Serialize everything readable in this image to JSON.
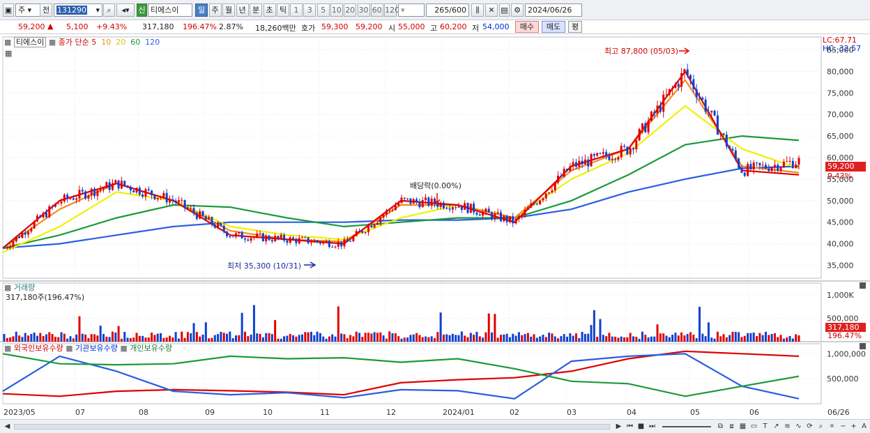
{
  "toolbar": {
    "type_label": "주",
    "prev_label": "전",
    "code": "131290",
    "stock_badge": "신",
    "stock_name": "티에스이",
    "periods": [
      "일",
      "주",
      "월",
      "년",
      "분",
      "초",
      "틱"
    ],
    "intervals": [
      "1",
      "3",
      "5",
      "10",
      "20",
      "30",
      "60",
      "120"
    ],
    "count": "265",
    "count_total": "/600",
    "date": "2024/06/26"
  },
  "quote": {
    "price": "59,200",
    "change": "5,100",
    "change_pct": "+9.43%",
    "volume": "317,180",
    "volume_pct": "196.47%",
    "turnover_pct": "2.87%",
    "amount": "18,260백만",
    "hoga_label": "호가",
    "ask": "59,300",
    "bid": "59,200",
    "open_label": "시",
    "open": "55,000",
    "high_label": "고",
    "high": "60,200",
    "low_label": "저",
    "low": "54,000",
    "buy_label": "매수",
    "sell_label": "매도",
    "avg_label": "평"
  },
  "legend": {
    "name": "티에스이",
    "price_label": "종가",
    "ma_label": "단순",
    "ma_periods": [
      "5",
      "10",
      "20",
      "60",
      "120"
    ],
    "ma_colors": [
      "#e00000",
      "#f08c1e",
      "#f0f000",
      "#1a9a3a",
      "#2a5ee0"
    ],
    "lc": "LC:67.71",
    "hc": "HC:-32.57"
  },
  "annotations": {
    "high": "최고 87,800 (05/03)",
    "low": "최저 35,300 (10/31)",
    "dividend": "배당락(0.00%)",
    "last_price": "59,200",
    "last_pct": "9.43%"
  },
  "volume_panel": {
    "title": "거래량",
    "value": "317,180주(196.47%)",
    "last": "317,180",
    "last_pct": "196.47%",
    "ticks": [
      "1,000K",
      "500,000"
    ]
  },
  "holding_panel": {
    "legend": [
      "외국인보유수량",
      "기관보유수량",
      "개인보유수량"
    ],
    "colors": [
      "#e00000",
      "#2a5ee0",
      "#1a9a3a"
    ],
    "ticks": [
      "1,000,000",
      "500,000"
    ]
  },
  "x_labels": [
    "2023/05",
    "07",
    "08",
    "09",
    "10",
    "11",
    "12",
    "2024/01",
    "02",
    "03",
    "04",
    "05",
    "06",
    "06/26"
  ],
  "chart_data": {
    "type": "candlestick",
    "ylim": [
      32000,
      88000
    ],
    "yticks": [
      35000,
      40000,
      45000,
      50000,
      55000,
      60000,
      65000,
      70000,
      75000,
      80000,
      85000
    ],
    "x": [
      "2023/05",
      "2023/06",
      "2023/07",
      "2023/08",
      "2023/09",
      "2023/10",
      "2023/11",
      "2023/12",
      "2024/01",
      "2024/02",
      "2024/03",
      "2024/04",
      "2024/05",
      "2024/06",
      "2024/06/26"
    ],
    "close": [
      39000,
      50000,
      54000,
      50000,
      42000,
      41000,
      40000,
      50000,
      49000,
      45000,
      58000,
      62000,
      80000,
      57000,
      59200
    ],
    "series": [
      {
        "name": "5",
        "values": [
          39000,
          50000,
          54000,
          50000,
          42000,
          41000,
          40000,
          50000,
          49000,
          45000,
          58000,
          62000,
          80000,
          57000,
          56000
        ]
      },
      {
        "name": "10",
        "values": [
          39000,
          48000,
          54000,
          50000,
          43000,
          41000,
          40500,
          49000,
          49000,
          46000,
          57000,
          62000,
          78000,
          58000,
          56500
        ]
      },
      {
        "name": "20",
        "values": [
          38000,
          44000,
          52000,
          50000,
          44000,
          42000,
          41000,
          46000,
          49000,
          46000,
          55000,
          61000,
          72000,
          62000,
          57500
        ]
      },
      {
        "name": "60",
        "values": [
          39000,
          42000,
          46000,
          49000,
          48500,
          46000,
          44000,
          45000,
          46000,
          46000,
          50000,
          56000,
          63000,
          65000,
          64000
        ]
      },
      {
        "name": "120",
        "values": [
          39000,
          40000,
          42000,
          44000,
          45000,
          45000,
          45000,
          45500,
          45500,
          46000,
          48000,
          52000,
          55000,
          57500,
          58000
        ]
      }
    ],
    "high_point": {
      "label": "2024/05/03",
      "value": 87800
    },
    "low_point": {
      "label": "2023/10/31",
      "value": 35300
    }
  }
}
